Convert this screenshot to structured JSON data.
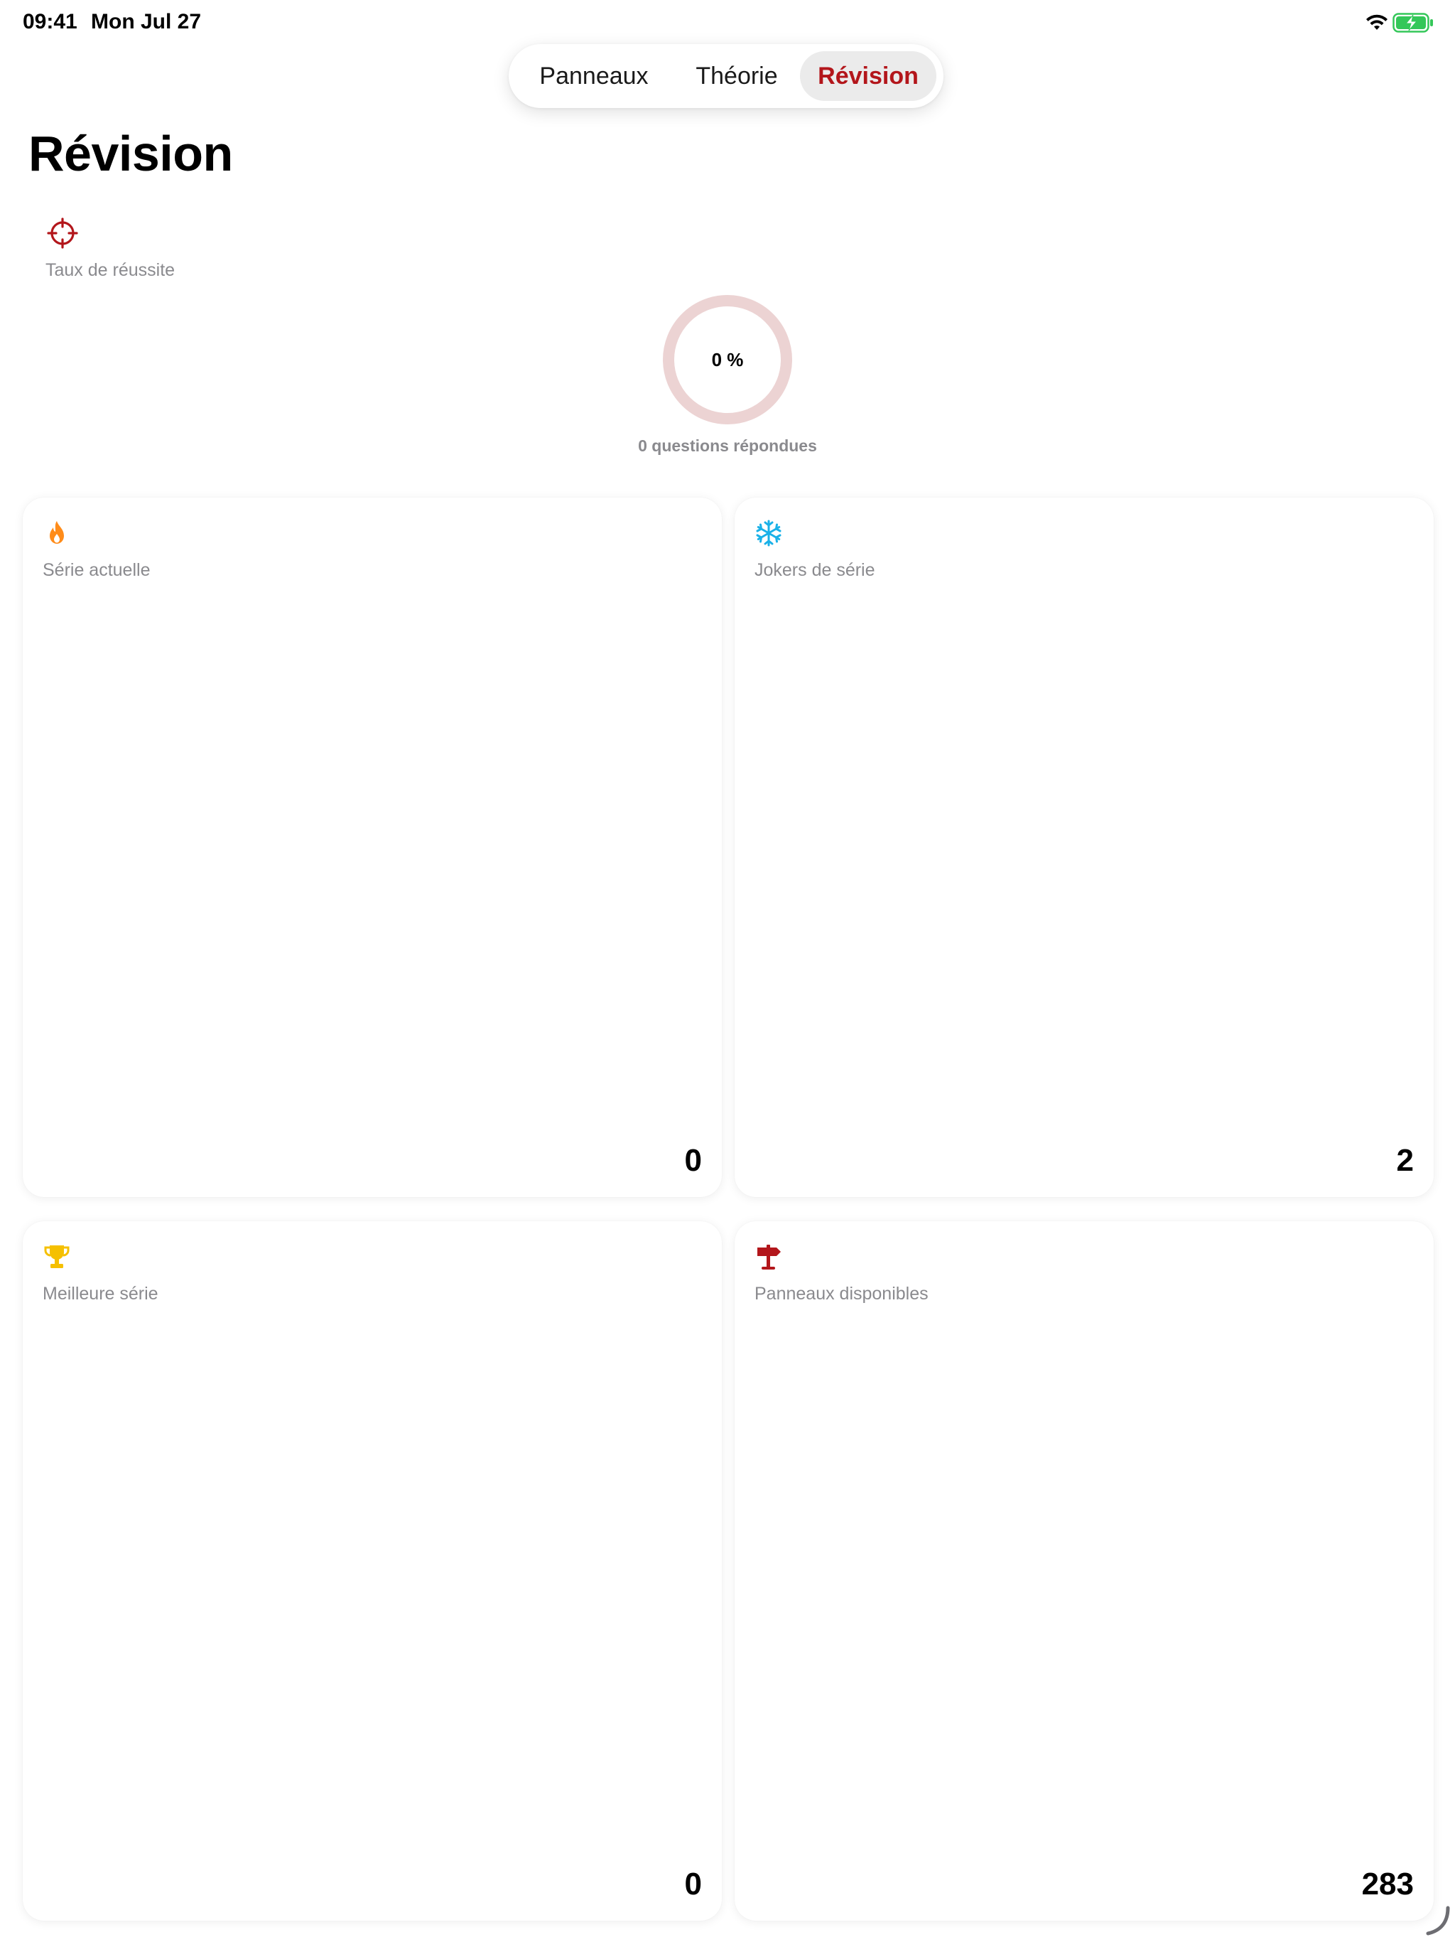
{
  "status_bar": {
    "time": "09:41",
    "date": "Mon Jul 27",
    "battery_color": "#34c759"
  },
  "tabs": [
    {
      "label": "Panneaux",
      "selected": false
    },
    {
      "label": "Théorie",
      "selected": false
    },
    {
      "label": "Révision",
      "selected": true
    }
  ],
  "page": {
    "title": "Révision"
  },
  "success_rate": {
    "label": "Taux de réussite",
    "value_text": "0 %",
    "value": 0,
    "answered_text": "0 questions répondues",
    "ring_color": "#ecd3d3",
    "icon": "target-icon",
    "icon_color": "#b3161b"
  },
  "cards": [
    {
      "label": "Série actuelle",
      "value": "0",
      "icon": "flame-icon",
      "icon_color": "#ff8c1a"
    },
    {
      "label": "Jokers de série",
      "value": "2",
      "icon": "snowflake-icon",
      "icon_color": "#1ab1e8"
    },
    {
      "label": "Meilleure série",
      "value": "0",
      "icon": "trophy-icon",
      "icon_color": "#f5c000"
    },
    {
      "label": "Panneaux disponibles",
      "value": "283",
      "icon": "signpost-icon",
      "icon_color": "#b3161b"
    }
  ],
  "accent_color": "#b3161b"
}
